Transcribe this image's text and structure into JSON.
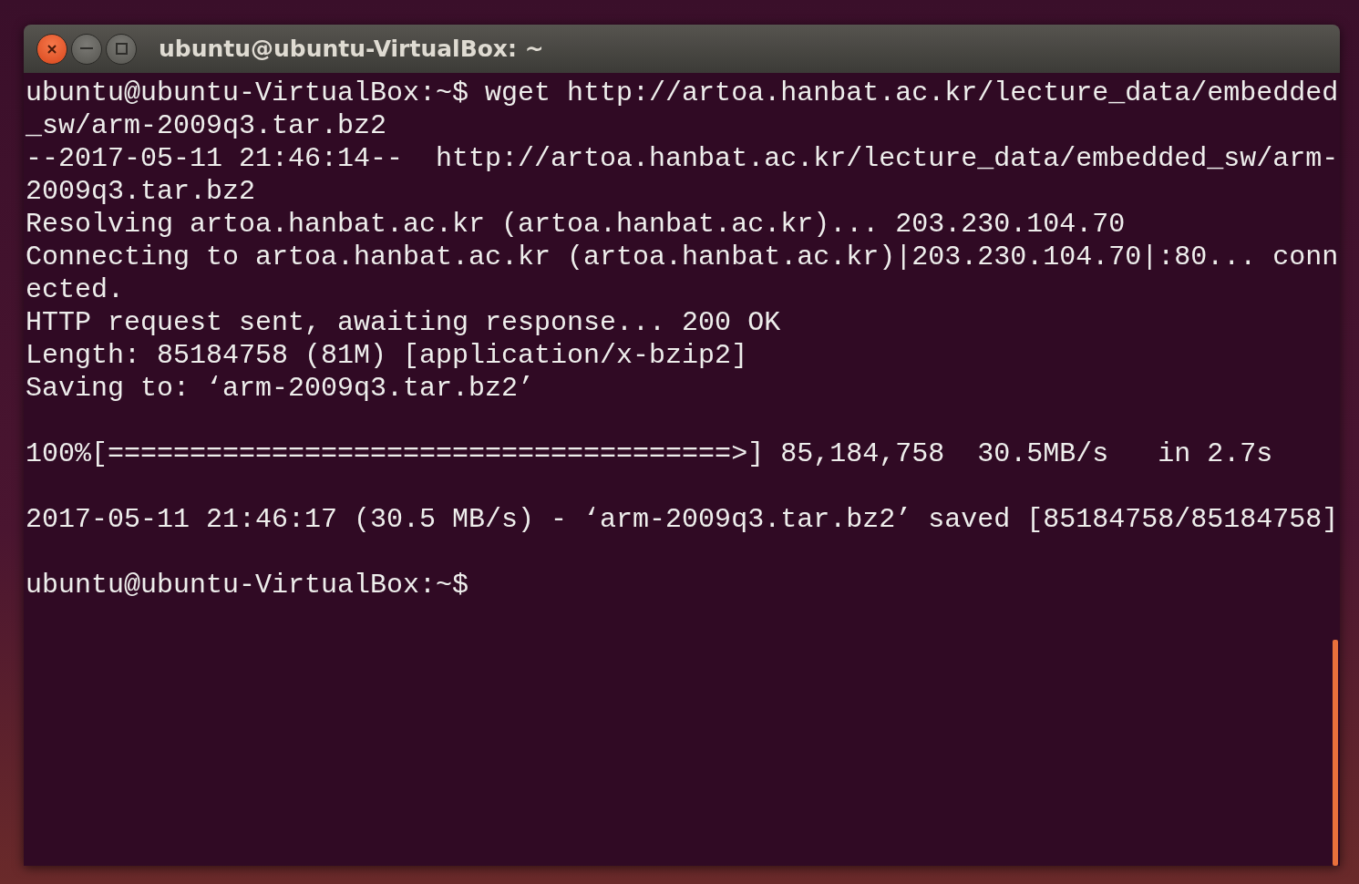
{
  "window": {
    "title": "ubuntu@ubuntu-VirtualBox: ~"
  },
  "terminal": {
    "blocks": [
      {
        "lines": [
          "ubuntu@ubuntu-VirtualBox:~$ wget http://artoa.hanbat.ac.kr/lecture_data/embedded",
          "_sw/arm-2009q3.tar.bz2",
          "--2017-05-11 21:46:14--  http://artoa.hanbat.ac.kr/lecture_data/embedded_sw/arm-",
          "2009q3.tar.bz2",
          "Resolving artoa.hanbat.ac.kr (artoa.hanbat.ac.kr)... 203.230.104.70",
          "Connecting to artoa.hanbat.ac.kr (artoa.hanbat.ac.kr)|203.230.104.70|:80... conn",
          "ected.",
          "HTTP request sent, awaiting response... 200 OK",
          "Length: 85184758 (81M) [application/x-bzip2]",
          "Saving to: ‘arm-2009q3.tar.bz2’"
        ]
      },
      {
        "lines": [
          "100%[======================================>] 85,184,758  30.5MB/s   in 2.7s"
        ]
      },
      {
        "lines": [
          "2017-05-11 21:46:17 (30.5 MB/s) - ‘arm-2009q3.tar.bz2’ saved [85184758/85184758]"
        ]
      },
      {
        "lines": [
          "ubuntu@ubuntu-VirtualBox:~$"
        ]
      }
    ]
  }
}
